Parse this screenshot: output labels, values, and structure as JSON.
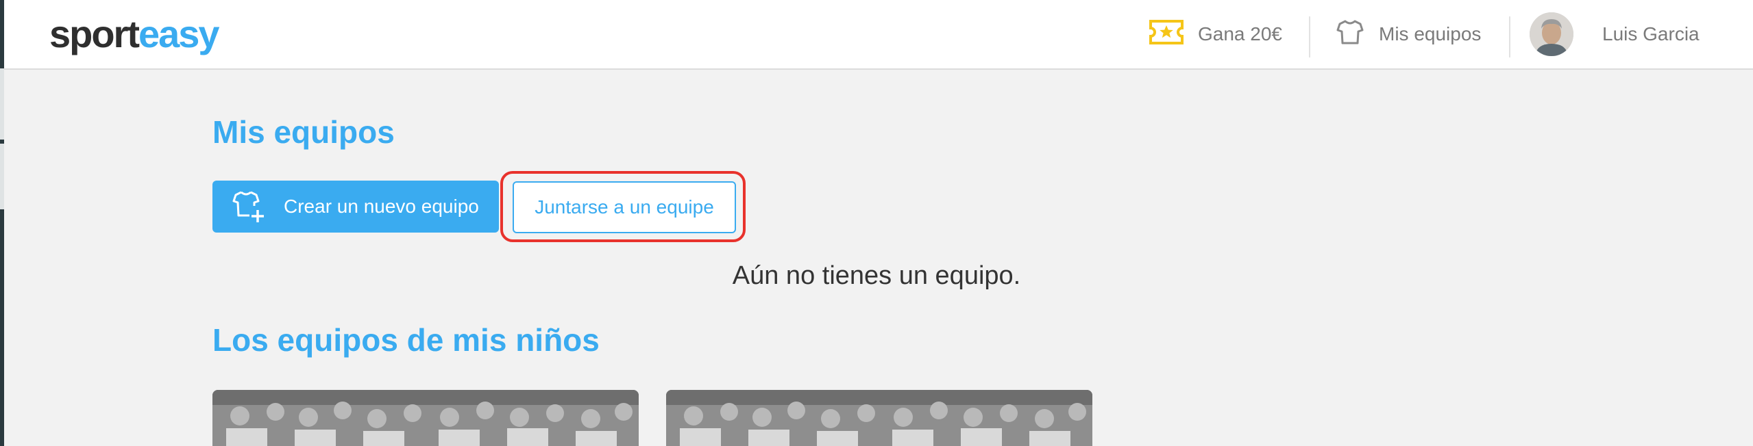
{
  "header": {
    "logo": {
      "part1": "sport",
      "part2": "easy"
    },
    "nav": {
      "earn": {
        "label": "Gana 20€",
        "icon": "ticket-star-icon",
        "color": "#f5c518"
      },
      "teams": {
        "label": "Mis equipos",
        "icon": "tshirt-icon"
      },
      "user": {
        "label": "Luis Garcia",
        "icon": "avatar"
      }
    }
  },
  "main": {
    "my_teams": {
      "title": "Mis equipos",
      "create_button": {
        "label": "Crear un nuevo equipo",
        "icon": "tshirt-plus-icon"
      },
      "join_button": {
        "label": "Juntarse a un equipe"
      },
      "empty_message": "Aún no tienes un equipo."
    },
    "kids_teams": {
      "title": "Los equipos de mis niños",
      "cards": [
        {
          "name": "team-photo-1"
        },
        {
          "name": "team-photo-2"
        }
      ]
    }
  },
  "colors": {
    "accent": "#3aabf0",
    "highlight": "#e8322c",
    "background": "#f2f2f2"
  }
}
